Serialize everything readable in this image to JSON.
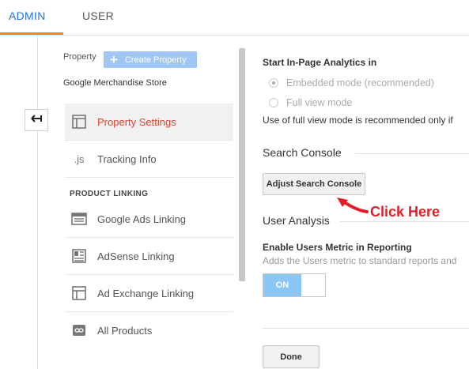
{
  "tabs": {
    "admin": "ADMIN",
    "user": "USER"
  },
  "property": {
    "label": "Property",
    "create_button": "Create Property",
    "name": "Google Merchandise Store"
  },
  "nav": {
    "property_settings": "Property Settings",
    "tracking_info": "Tracking Info",
    "tracking_icon_text": ".js",
    "section_heading": "PRODUCT LINKING",
    "google_ads": "Google Ads Linking",
    "adsense": "AdSense Linking",
    "ad_exchange": "Ad Exchange Linking",
    "all_products": "All Products"
  },
  "settings": {
    "inpage_title": "Start In-Page Analytics in",
    "embedded_mode": "Embedded mode (recommended)",
    "full_view_mode": "Full view mode",
    "full_view_note": "Use of full view mode is recommended only if",
    "search_console_heading": "Search Console",
    "adjust_button": "Adjust Search Console",
    "user_analysis_heading": "User Analysis",
    "users_metric_title": "Enable Users Metric in Reporting",
    "users_metric_desc": "Adds the Users metric to standard reports and",
    "toggle_label": "ON",
    "done_button": "Done"
  },
  "annotation": {
    "callout": "Click Here",
    "color": "#e31e24"
  },
  "colors": {
    "accent": "#1a73e8",
    "tab_underline": "#f5871f",
    "active_nav": "#e0402a"
  }
}
